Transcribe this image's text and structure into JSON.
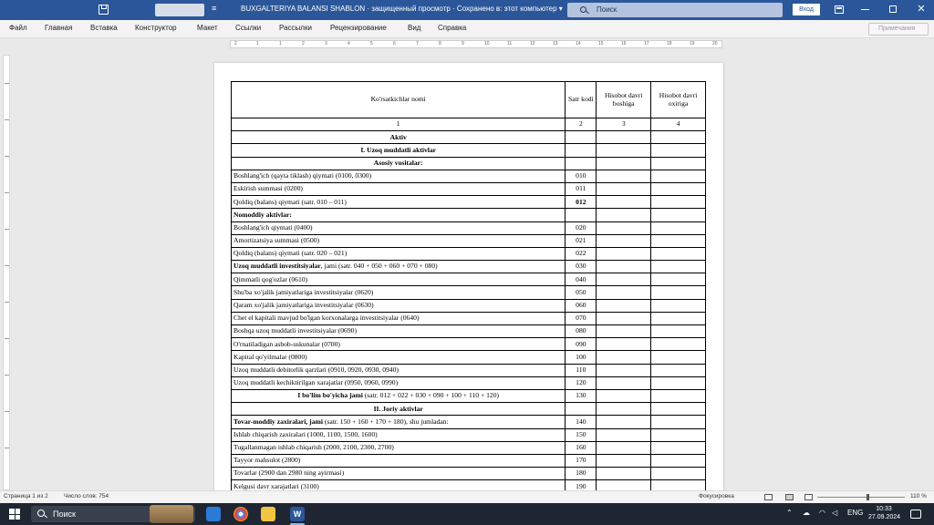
{
  "titlebar": {
    "doc_title": "BUXGALTERIYA BALANSI SHABLON  ·  защищенный просмотр  ·  Сохранено в: этот компьютер  ▾",
    "search_placeholder": "Поиск",
    "login_label": "Вход",
    "qa_menu": "≡"
  },
  "ribbon": {
    "tabs": [
      "Файл",
      "Главная",
      "Вставка",
      "Конструктор",
      "Макет",
      "Ссылки",
      "Рассылки",
      "Рецензирование",
      "Вид",
      "Справка"
    ],
    "comments_label": "Примечания"
  },
  "ruler": {
    "labels": [
      "2",
      "1",
      "1",
      "2",
      "3",
      "4",
      "5",
      "6",
      "7",
      "8",
      "9",
      "10",
      "11",
      "12",
      "13",
      "14",
      "15",
      "16",
      "17",
      "18",
      "19",
      "20"
    ]
  },
  "table": {
    "header": {
      "name": "Ko'rsatkichlar nomi",
      "code": "Satr kodi",
      "start": "Hisobot davri boshiga",
      "end": "Hisobot davri oxiriga"
    },
    "numbering": [
      "1",
      "2",
      "3",
      "4"
    ],
    "rows": [
      {
        "name": "Aktiv",
        "code": "",
        "style": "center-bold"
      },
      {
        "name": "I. Uzoq muddatli aktivlar",
        "code": "",
        "style": "center-bold"
      },
      {
        "name": "Asosiy vositalar:",
        "code": "",
        "style": "center-bold"
      },
      {
        "name": "Boshlang'ich (qayta tiklash) qiymati (0100, 0300)",
        "code": "010",
        "style": "normal"
      },
      {
        "name": "Eskirish summasi (0200)",
        "code": "011",
        "style": "normal"
      },
      {
        "name": "Qoldiq (balans) qiymati (satr. 010 – 011)",
        "code": "012",
        "style": "code-bold"
      },
      {
        "name": "Nomoddiy aktivlar:",
        "code": "",
        "style": "bold"
      },
      {
        "name": "Boshlang'ich qiymati (0400)",
        "code": "020",
        "style": "normal"
      },
      {
        "name": "Amortizatsiya summasi (0500)",
        "code": "021",
        "style": "normal"
      },
      {
        "name": "Qoldiq (balans) qiymati (satr. 020 – 021)",
        "code": "022",
        "style": "normal"
      },
      {
        "name_bold": "Uzoq muddatli investitsiyalar",
        "name": ", jami (satr. 040 + 050 + 060 + 070 + 080)",
        "code": "030",
        "style": "mixed"
      },
      {
        "name": "Qimmatli qog'ozlar (0610)",
        "code": "040",
        "style": "normal"
      },
      {
        "name": "Shu'ba xo'jalik jamiyatlariga investitsiyalar (0620)",
        "code": "050",
        "style": "normal"
      },
      {
        "name": "Qaram xo'jalik jamiyatlariga investitsiyalar (0630)",
        "code": "060",
        "style": "normal"
      },
      {
        "name": "Chet el kapitali mavjud bo'lgan korxonalarga investitsiyalar (0640)",
        "code": "070",
        "style": "normal"
      },
      {
        "name": "Boshqa uzoq muddatli investitsiyalar (0690)",
        "code": "080",
        "style": "normal"
      },
      {
        "name": "O'rnatiladigan asbob-uskunalar (0700)",
        "code": "090",
        "style": "normal"
      },
      {
        "name": "Kapital qo'yilmalar (0800)",
        "code": "100",
        "style": "normal"
      },
      {
        "name": "Uzoq muddatli debitorlik qarzlari (0910, 0920, 0930, 0940)",
        "code": "110",
        "style": "normal"
      },
      {
        "name": "Uzoq muddatli kechiktirilgan xarajatlar (0950, 0960, 0990)",
        "code": "120",
        "style": "normal"
      },
      {
        "name_bold": "I bo'lim bo'yicha jami",
        "name": " (satr. 012 + 022 + 030 + 090 + 100 + 110 + 120)",
        "code": "130",
        "style": "mixed-center"
      },
      {
        "name": "II. Joriy aktivlar",
        "code": "",
        "style": "center-bold"
      },
      {
        "name_bold": "Tovar-moddiy zaxiralari, jami",
        "name": " (satr. 150 + 160 + 170 + 180), shu jumladan:",
        "code": "140",
        "style": "mixed"
      },
      {
        "name": "Ishlab chiqarish zaxiralari (1000, 1100, 1500, 1600)",
        "code": "150",
        "style": "normal"
      },
      {
        "name": "Tugallanmagan ishlab chiqarish (2000, 2100, 2300, 2700)",
        "code": "160",
        "style": "normal"
      },
      {
        "name": "Tayyor mahsulot (2800)",
        "code": "170",
        "style": "normal"
      },
      {
        "name": "Tovarlar (2900 dan 2980 ning ayirmasi)",
        "code": "180",
        "style": "normal"
      },
      {
        "name": "Kelgusi davr xarajatlari (3100)",
        "code": "190",
        "style": "normal"
      }
    ]
  },
  "statusbar": {
    "page": "Страница 1 из 2",
    "words": "Число слов: 754",
    "focus": "Фокусировка",
    "zoom": "110 %"
  },
  "taskbar": {
    "search_placeholder": "Поиск",
    "lang": "ENG",
    "time": "10:33",
    "date": "27.09.2024"
  }
}
